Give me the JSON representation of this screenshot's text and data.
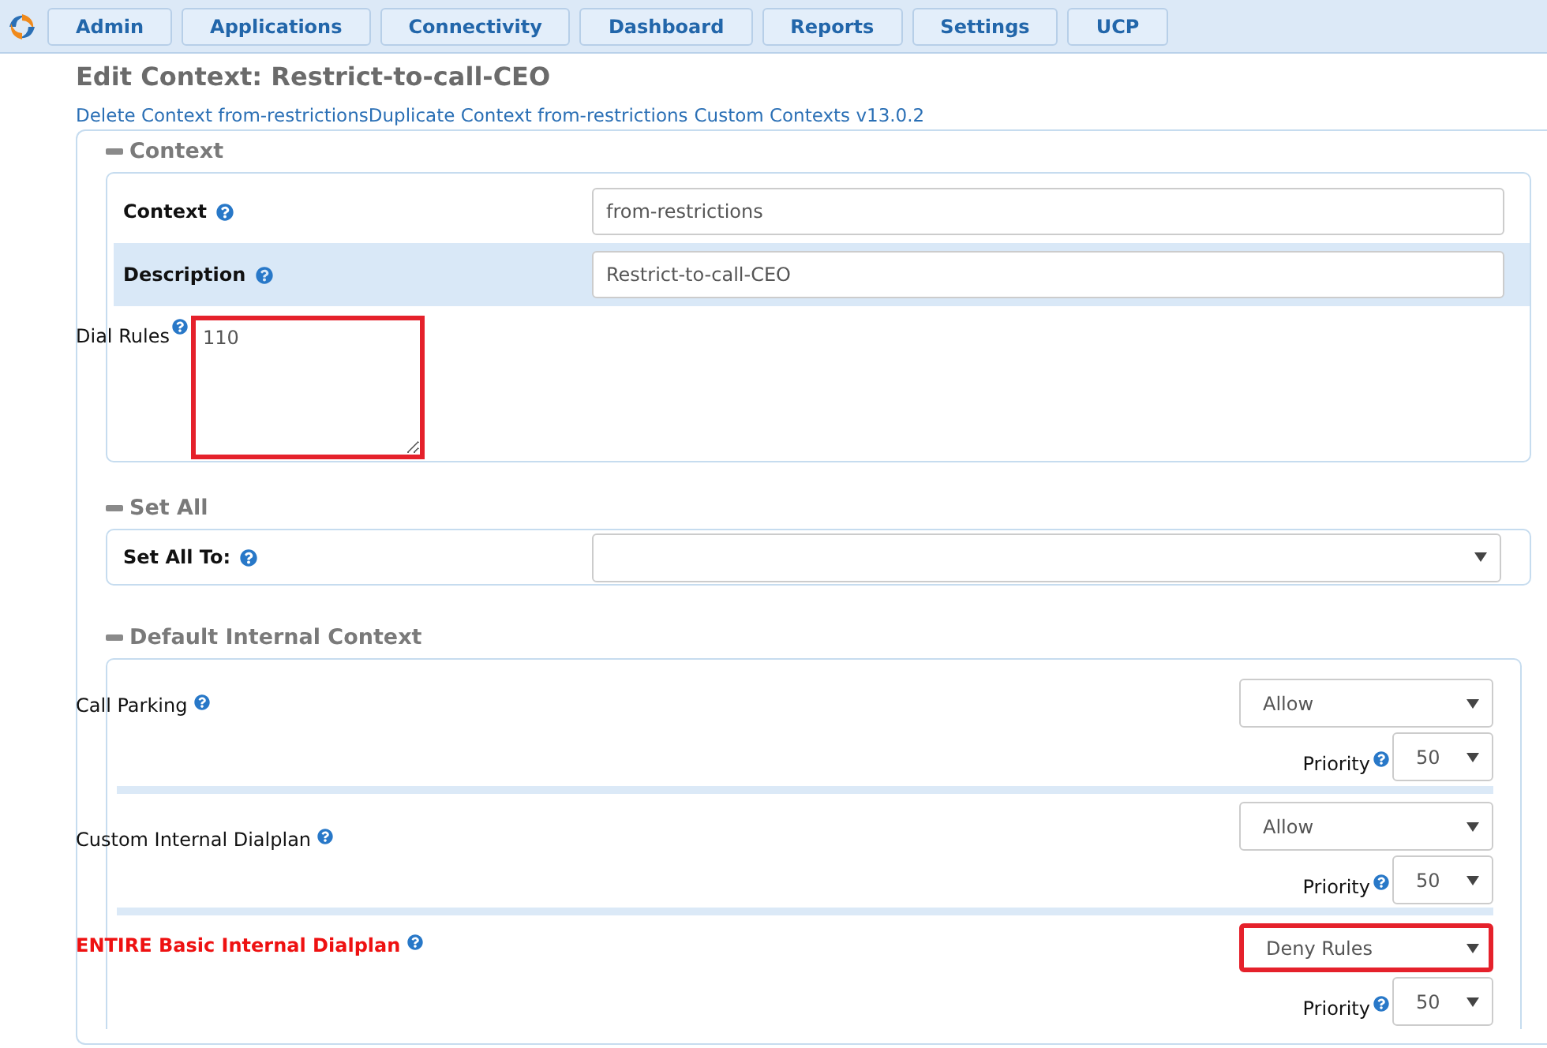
{
  "nav": {
    "items": [
      {
        "label": "Admin"
      },
      {
        "label": "Applications"
      },
      {
        "label": "Connectivity"
      },
      {
        "label": "Dashboard"
      },
      {
        "label": "Reports"
      },
      {
        "label": "Settings"
      },
      {
        "label": "UCP"
      }
    ]
  },
  "page_title": "Edit Context: Restrict-to-call-CEO",
  "links": [
    {
      "label": "Delete Context from-restrictions"
    },
    {
      "label": "Duplicate Context from-restrictions"
    },
    {
      "label": "Custom Contexts v13.0.2"
    }
  ],
  "context_section": {
    "title": "Context",
    "fields": [
      {
        "label": "Context",
        "value": "from-restrictions",
        "active": false
      },
      {
        "label": "Description",
        "value": "Restrict-to-call-CEO",
        "active": true
      }
    ],
    "dial_rules": {
      "label": "Dial Rules",
      "value": "110",
      "annotated": true
    }
  },
  "set_all_section": {
    "title": "Set All",
    "label": "Set All To:"
  },
  "internal_section": {
    "title": "Default Internal Context",
    "rules": [
      {
        "label": "Call Parking",
        "emphasis": false,
        "permission": "Allow",
        "annotated": false,
        "priority_label": "Priority",
        "priority": "50"
      },
      {
        "label": "Custom Internal Dialplan",
        "emphasis": false,
        "permission": "Allow",
        "annotated": false,
        "priority_label": "Priority",
        "priority": "50"
      },
      {
        "label": "ENTIRE Basic Internal Dialplan",
        "emphasis": true,
        "permission": "Deny Rules",
        "annotated": true,
        "priority_label": "Priority",
        "priority": "50"
      }
    ]
  }
}
